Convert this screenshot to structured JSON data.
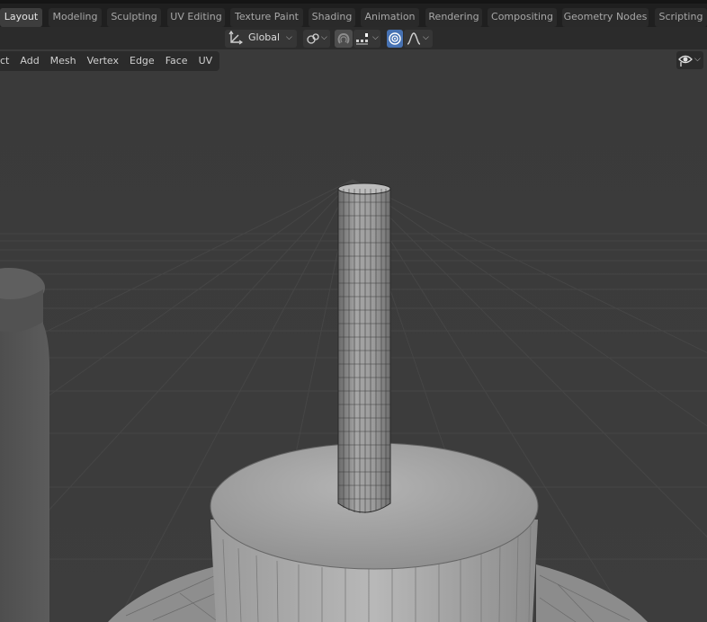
{
  "workspace_tabs": [
    {
      "label": "Layout",
      "active": true
    },
    {
      "label": "Modeling",
      "active": false
    },
    {
      "label": "Sculpting",
      "active": false
    },
    {
      "label": "UV Editing",
      "active": false
    },
    {
      "label": "Texture Paint",
      "active": false
    },
    {
      "label": "Shading",
      "active": false
    },
    {
      "label": "Animation",
      "active": false
    },
    {
      "label": "Rendering",
      "active": false
    },
    {
      "label": "Compositing",
      "active": false
    },
    {
      "label": "Geometry Nodes",
      "active": false
    },
    {
      "label": "Scripting",
      "active": false
    }
  ],
  "tool_header": {
    "transform_orientation": "Global",
    "snap_active": true,
    "proportional_editing": true
  },
  "viewport_menu": [
    "ct",
    "Add",
    "Mesh",
    "Vertex",
    "Edge",
    "Face",
    "UV"
  ],
  "colors": {
    "accent_blue": "#4772b3",
    "viewport_bg": "#3b3b3b",
    "header_bg": "#2b2b2b"
  },
  "icons": {
    "orientation": "transform-orientation-icon",
    "pivot": "pivot-point-icon",
    "snap": "snap-magnet-icon",
    "snap_target": "snap-increment-icon",
    "proportional": "proportional-editing-icon",
    "falloff": "falloff-curve-icon",
    "visibility": "visibility-eye-icon"
  }
}
